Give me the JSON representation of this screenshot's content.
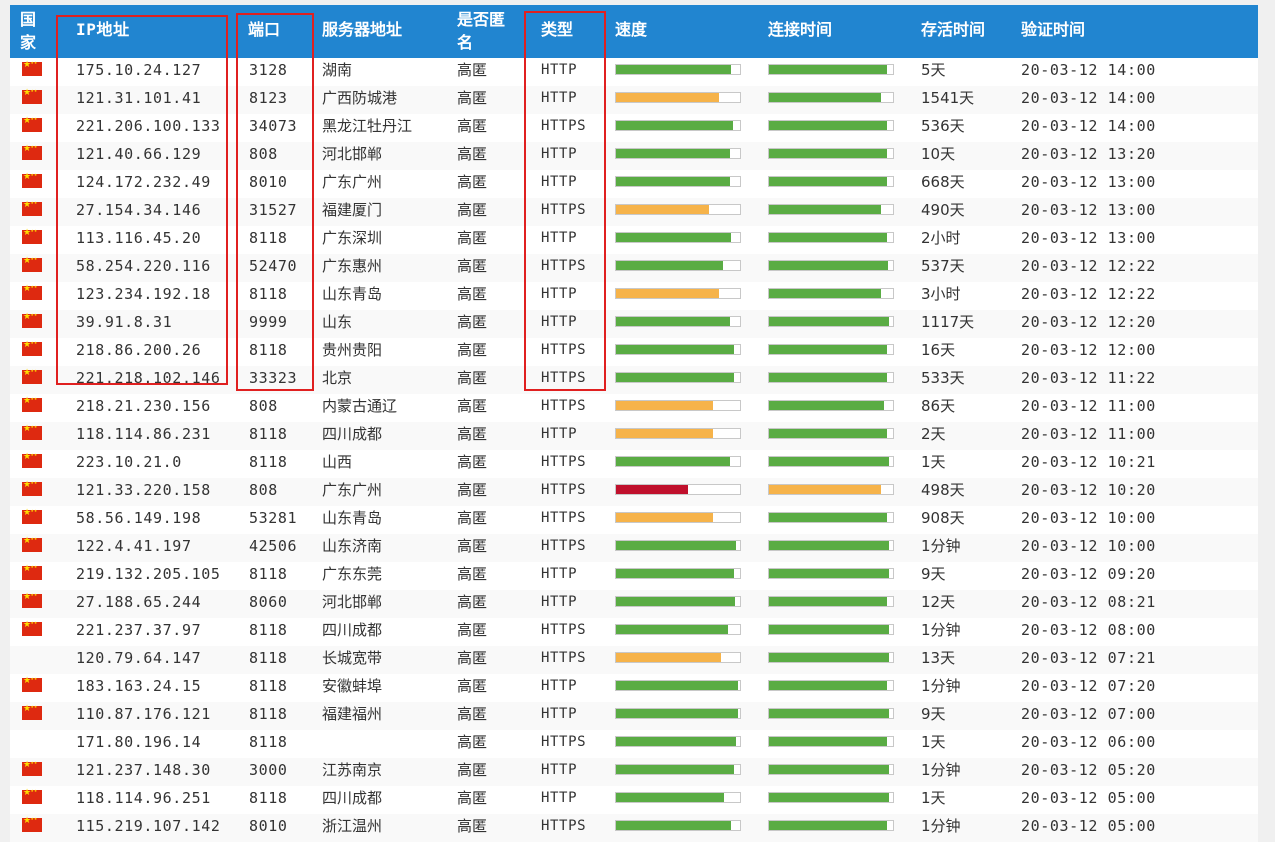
{
  "colors": {
    "header_bg": "#2185d0",
    "bar_good": "#5aac44",
    "bar_medium": "#f6b34a",
    "bar_poor": "#c0102c",
    "highlight_border": "#e02020"
  },
  "header": {
    "country": "国家",
    "ip": "IP地址",
    "port": "端口",
    "server": "服务器地址",
    "anonymity": "是否匿名",
    "type": "类型",
    "speed": "速度",
    "connect_time": "连接时间",
    "alive_time": "存活时间",
    "verified": "验证时间"
  },
  "rows": [
    {
      "flag": true,
      "ip": "175.10.24.127",
      "port": "3128",
      "server": "湖南",
      "anon": "高匿",
      "type": "HTTP",
      "speed": {
        "level": 0.93,
        "rating": "good"
      },
      "connect": {
        "level": 0.95,
        "rating": "good"
      },
      "alive": "5天",
      "verified": "20-03-12 14:00"
    },
    {
      "flag": true,
      "ip": "121.31.101.41",
      "port": "8123",
      "server": "广西防城港",
      "anon": "高匿",
      "type": "HTTP",
      "speed": {
        "level": 0.83,
        "rating": "medium"
      },
      "connect": {
        "level": 0.9,
        "rating": "good"
      },
      "alive": "1541天",
      "verified": "20-03-12 14:00"
    },
    {
      "flag": true,
      "ip": "221.206.100.133",
      "port": "34073",
      "server": "黑龙江牡丹江",
      "anon": "高匿",
      "type": "HTTPS",
      "speed": {
        "level": 0.94,
        "rating": "good"
      },
      "connect": {
        "level": 0.95,
        "rating": "good"
      },
      "alive": "536天",
      "verified": "20-03-12 14:00"
    },
    {
      "flag": true,
      "ip": "121.40.66.129",
      "port": "808",
      "server": "河北邯郸",
      "anon": "高匿",
      "type": "HTTP",
      "speed": {
        "level": 0.92,
        "rating": "good"
      },
      "connect": {
        "level": 0.95,
        "rating": "good"
      },
      "alive": "10天",
      "verified": "20-03-12 13:20"
    },
    {
      "flag": true,
      "ip": "124.172.232.49",
      "port": "8010",
      "server": "广东广州",
      "anon": "高匿",
      "type": "HTTP",
      "speed": {
        "level": 0.92,
        "rating": "good"
      },
      "connect": {
        "level": 0.95,
        "rating": "good"
      },
      "alive": "668天",
      "verified": "20-03-12 13:00"
    },
    {
      "flag": true,
      "ip": "27.154.34.146",
      "port": "31527",
      "server": "福建厦门",
      "anon": "高匿",
      "type": "HTTPS",
      "speed": {
        "level": 0.75,
        "rating": "medium"
      },
      "connect": {
        "level": 0.9,
        "rating": "good"
      },
      "alive": "490天",
      "verified": "20-03-12 13:00"
    },
    {
      "flag": true,
      "ip": "113.116.45.20",
      "port": "8118",
      "server": "广东深圳",
      "anon": "高匿",
      "type": "HTTP",
      "speed": {
        "level": 0.93,
        "rating": "good"
      },
      "connect": {
        "level": 0.95,
        "rating": "good"
      },
      "alive": "2小时",
      "verified": "20-03-12 13:00"
    },
    {
      "flag": true,
      "ip": "58.254.220.116",
      "port": "52470",
      "server": "广东惠州",
      "anon": "高匿",
      "type": "HTTPS",
      "speed": {
        "level": 0.86,
        "rating": "good"
      },
      "connect": {
        "level": 0.96,
        "rating": "good"
      },
      "alive": "537天",
      "verified": "20-03-12 12:22"
    },
    {
      "flag": true,
      "ip": "123.234.192.18",
      "port": "8118",
      "server": "山东青岛",
      "anon": "高匿",
      "type": "HTTP",
      "speed": {
        "level": 0.83,
        "rating": "medium"
      },
      "connect": {
        "level": 0.9,
        "rating": "good"
      },
      "alive": "3小时",
      "verified": "20-03-12 12:22"
    },
    {
      "flag": true,
      "ip": "39.91.8.31",
      "port": "9999",
      "server": "山东",
      "anon": "高匿",
      "type": "HTTP",
      "speed": {
        "level": 0.92,
        "rating": "good"
      },
      "connect": {
        "level": 0.97,
        "rating": "good"
      },
      "alive": "1117天",
      "verified": "20-03-12 12:20"
    },
    {
      "flag": true,
      "ip": "218.86.200.26",
      "port": "8118",
      "server": "贵州贵阳",
      "anon": "高匿",
      "type": "HTTPS",
      "speed": {
        "level": 0.95,
        "rating": "good"
      },
      "connect": {
        "level": 0.95,
        "rating": "good"
      },
      "alive": "16天",
      "verified": "20-03-12 12:00"
    },
    {
      "flag": true,
      "ip": "221.218.102.146",
      "port": "33323",
      "server": "北京",
      "anon": "高匿",
      "type": "HTTPS",
      "speed": {
        "level": 0.95,
        "rating": "good"
      },
      "connect": {
        "level": 0.95,
        "rating": "good"
      },
      "alive": "533天",
      "verified": "20-03-12 11:22"
    },
    {
      "flag": true,
      "ip": "218.21.230.156",
      "port": "808",
      "server": "内蒙古通辽",
      "anon": "高匿",
      "type": "HTTPS",
      "speed": {
        "level": 0.78,
        "rating": "medium"
      },
      "connect": {
        "level": 0.93,
        "rating": "good"
      },
      "alive": "86天",
      "verified": "20-03-12 11:00"
    },
    {
      "flag": true,
      "ip": "118.114.86.231",
      "port": "8118",
      "server": "四川成都",
      "anon": "高匿",
      "type": "HTTP",
      "speed": {
        "level": 0.78,
        "rating": "medium"
      },
      "connect": {
        "level": 0.95,
        "rating": "good"
      },
      "alive": "2天",
      "verified": "20-03-12 11:00"
    },
    {
      "flag": true,
      "ip": "223.10.21.0",
      "port": "8118",
      "server": "山西",
      "anon": "高匿",
      "type": "HTTPS",
      "speed": {
        "level": 0.92,
        "rating": "good"
      },
      "connect": {
        "level": 0.97,
        "rating": "good"
      },
      "alive": "1天",
      "verified": "20-03-12 10:21"
    },
    {
      "flag": true,
      "ip": "121.33.220.158",
      "port": "808",
      "server": "广东广州",
      "anon": "高匿",
      "type": "HTTPS",
      "speed": {
        "level": 0.58,
        "rating": "poor"
      },
      "connect": {
        "level": 0.9,
        "rating": "medium"
      },
      "alive": "498天",
      "verified": "20-03-12 10:20"
    },
    {
      "flag": true,
      "ip": "58.56.149.198",
      "port": "53281",
      "server": "山东青岛",
      "anon": "高匿",
      "type": "HTTPS",
      "speed": {
        "level": 0.78,
        "rating": "medium"
      },
      "connect": {
        "level": 0.95,
        "rating": "good"
      },
      "alive": "908天",
      "verified": "20-03-12 10:00"
    },
    {
      "flag": true,
      "ip": "122.4.41.197",
      "port": "42506",
      "server": "山东济南",
      "anon": "高匿",
      "type": "HTTPS",
      "speed": {
        "level": 0.97,
        "rating": "good"
      },
      "connect": {
        "level": 0.97,
        "rating": "good"
      },
      "alive": "1分钟",
      "verified": "20-03-12 10:00"
    },
    {
      "flag": true,
      "ip": "219.132.205.105",
      "port": "8118",
      "server": "广东东莞",
      "anon": "高匿",
      "type": "HTTP",
      "speed": {
        "level": 0.95,
        "rating": "good"
      },
      "connect": {
        "level": 0.97,
        "rating": "good"
      },
      "alive": "9天",
      "verified": "20-03-12 09:20"
    },
    {
      "flag": true,
      "ip": "27.188.65.244",
      "port": "8060",
      "server": "河北邯郸",
      "anon": "高匿",
      "type": "HTTP",
      "speed": {
        "level": 0.96,
        "rating": "good"
      },
      "connect": {
        "level": 0.95,
        "rating": "good"
      },
      "alive": "12天",
      "verified": "20-03-12 08:21"
    },
    {
      "flag": true,
      "ip": "221.237.37.97",
      "port": "8118",
      "server": "四川成都",
      "anon": "高匿",
      "type": "HTTPS",
      "speed": {
        "level": 0.9,
        "rating": "good"
      },
      "connect": {
        "level": 0.97,
        "rating": "good"
      },
      "alive": "1分钟",
      "verified": "20-03-12 08:00"
    },
    {
      "flag": false,
      "ip": "120.79.64.147",
      "port": "8118",
      "server": "长城宽带",
      "anon": "高匿",
      "type": "HTTPS",
      "speed": {
        "level": 0.85,
        "rating": "medium"
      },
      "connect": {
        "level": 0.97,
        "rating": "good"
      },
      "alive": "13天",
      "verified": "20-03-12 07:21"
    },
    {
      "flag": true,
      "ip": "183.163.24.15",
      "port": "8118",
      "server": "安徽蚌埠",
      "anon": "高匿",
      "type": "HTTP",
      "speed": {
        "level": 0.98,
        "rating": "good"
      },
      "connect": {
        "level": 0.95,
        "rating": "good"
      },
      "alive": "1分钟",
      "verified": "20-03-12 07:20"
    },
    {
      "flag": true,
      "ip": "110.87.176.121",
      "port": "8118",
      "server": "福建福州",
      "anon": "高匿",
      "type": "HTTP",
      "speed": {
        "level": 0.98,
        "rating": "good"
      },
      "connect": {
        "level": 0.97,
        "rating": "good"
      },
      "alive": "9天",
      "verified": "20-03-12 07:00"
    },
    {
      "flag": false,
      "ip": "171.80.196.14",
      "port": "8118",
      "server": "",
      "anon": "高匿",
      "type": "HTTPS",
      "speed": {
        "level": 0.97,
        "rating": "good"
      },
      "connect": {
        "level": 0.95,
        "rating": "good"
      },
      "alive": "1天",
      "verified": "20-03-12 06:00"
    },
    {
      "flag": true,
      "ip": "121.237.148.30",
      "port": "3000",
      "server": "江苏南京",
      "anon": "高匿",
      "type": "HTTP",
      "speed": {
        "level": 0.95,
        "rating": "good"
      },
      "connect": {
        "level": 0.97,
        "rating": "good"
      },
      "alive": "1分钟",
      "verified": "20-03-12 05:20"
    },
    {
      "flag": true,
      "ip": "118.114.96.251",
      "port": "8118",
      "server": "四川成都",
      "anon": "高匿",
      "type": "HTTP",
      "speed": {
        "level": 0.87,
        "rating": "good"
      },
      "connect": {
        "level": 0.97,
        "rating": "good"
      },
      "alive": "1天",
      "verified": "20-03-12 05:00"
    },
    {
      "flag": true,
      "ip": "115.219.107.142",
      "port": "8010",
      "server": "浙江温州",
      "anon": "高匿",
      "type": "HTTPS",
      "speed": {
        "level": 0.93,
        "rating": "good"
      },
      "connect": {
        "level": 0.95,
        "rating": "good"
      },
      "alive": "1分钟",
      "verified": "20-03-12 05:00"
    }
  ]
}
